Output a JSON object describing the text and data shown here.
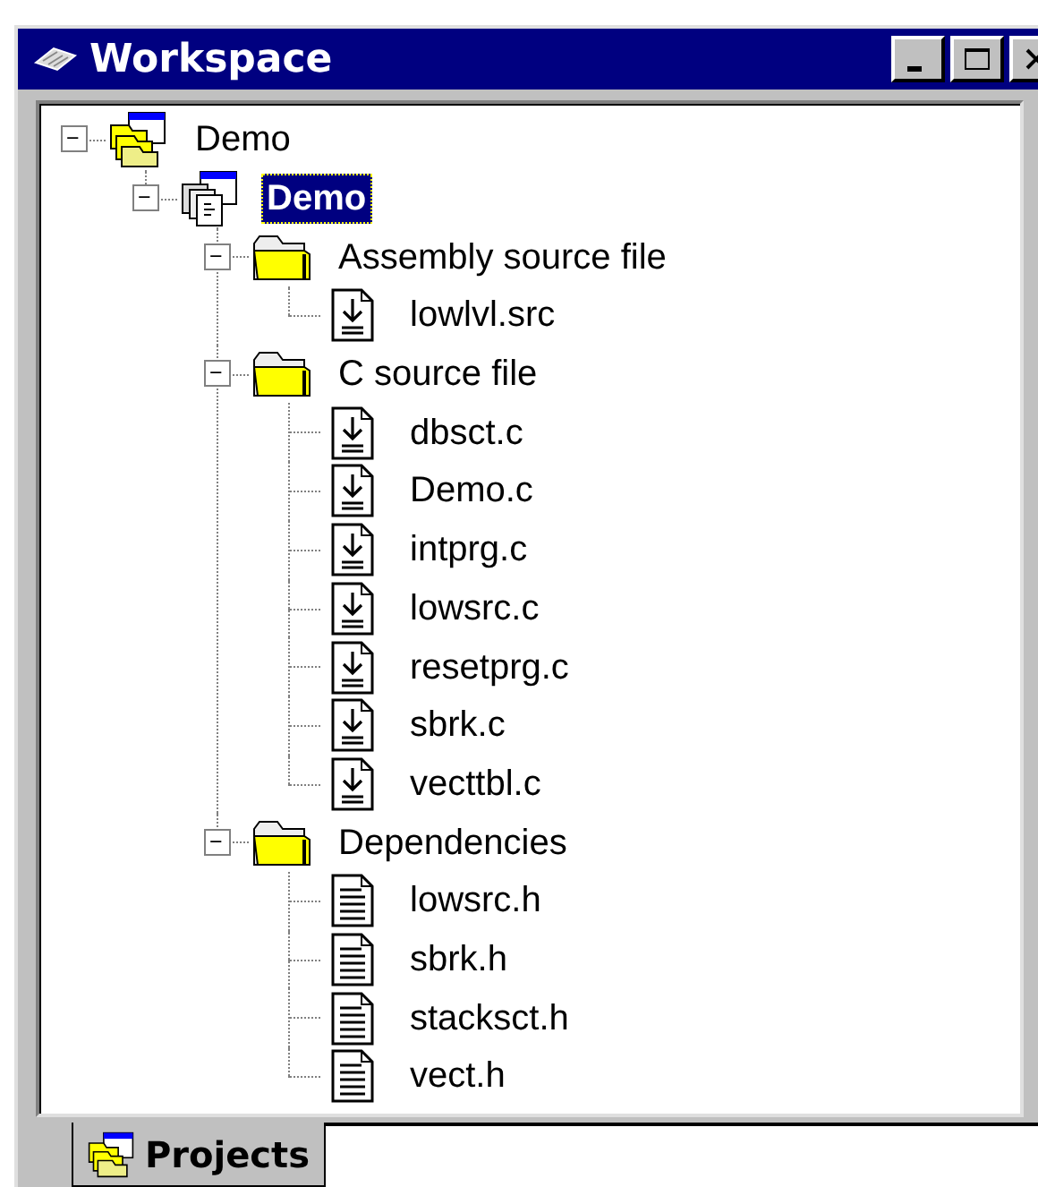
{
  "window": {
    "title": "Workspace"
  },
  "tree": [
    {
      "label": "Demo",
      "kind": "workspace",
      "expanded": true,
      "selected": false,
      "children": [
        {
          "label": "Demo",
          "kind": "project",
          "expanded": true,
          "selected": true,
          "children": [
            {
              "label": "Assembly source file",
              "kind": "folder",
              "expanded": true,
              "selected": false,
              "children": [
                {
                  "label": "lowlvl.src",
                  "kind": "source",
                  "selected": false
                }
              ]
            },
            {
              "label": "C source file",
              "kind": "folder",
              "expanded": true,
              "selected": false,
              "children": [
                {
                  "label": "dbsct.c",
                  "kind": "source",
                  "selected": false
                },
                {
                  "label": "Demo.c",
                  "kind": "source",
                  "selected": false
                },
                {
                  "label": "intprg.c",
                  "kind": "source",
                  "selected": false
                },
                {
                  "label": "lowsrc.c",
                  "kind": "source",
                  "selected": false
                },
                {
                  "label": "resetprg.c",
                  "kind": "source",
                  "selected": false
                },
                {
                  "label": "sbrk.c",
                  "kind": "source",
                  "selected": false
                },
                {
                  "label": "vecttbl.c",
                  "kind": "source",
                  "selected": false
                }
              ]
            },
            {
              "label": "Dependencies",
              "kind": "folder",
              "expanded": true,
              "selected": false,
              "children": [
                {
                  "label": "lowsrc.h",
                  "kind": "header",
                  "selected": false
                },
                {
                  "label": "sbrk.h",
                  "kind": "header",
                  "selected": false
                },
                {
                  "label": "stacksct.h",
                  "kind": "header",
                  "selected": false
                },
                {
                  "label": "vect.h",
                  "kind": "header",
                  "selected": false
                }
              ]
            }
          ]
        }
      ]
    }
  ],
  "tabs": [
    {
      "label": "Projects",
      "selected": true
    }
  ]
}
